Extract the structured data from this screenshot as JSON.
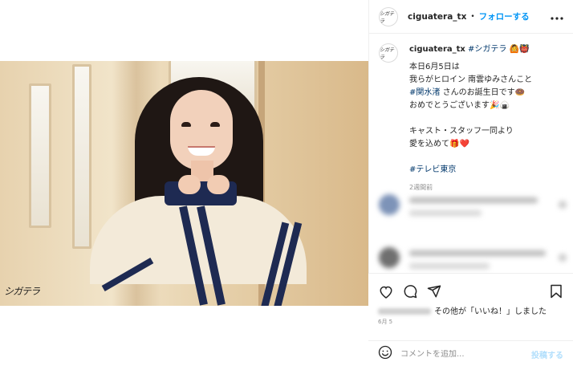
{
  "post": {
    "watermark": "シガテラ"
  },
  "header": {
    "avatar_text": "シガテラ",
    "username": "ciguatera_tx",
    "separator": "•",
    "follow_label": "フォローする",
    "more_icon": "more-horizontal-icon"
  },
  "caption": {
    "avatar_text": "シガテラ",
    "username": "ciguatera_tx",
    "hashtag_title": "#シガテラ",
    "title_emoji": "🙆👹",
    "lines": [
      "本日6月5日は",
      "我らがヒロイン 南雲ゆみさんこと",
      "さんのお誕生日です🍩",
      "おめでとうございます🎉🍙",
      "",
      "キャスト・スタッフ一同より",
      "愛を込めて🎁❤️",
      ""
    ],
    "actor_hashtag": "#関水渚",
    "footer_hashtag": "#テレビ東京",
    "time_ago": "2週間前"
  },
  "actions": {
    "icons": [
      "heart-icon",
      "comment-icon",
      "share-icon",
      "bookmark-icon"
    ],
    "likes_text": "その他が「いいね！」しました",
    "date": "6月 5"
  },
  "comment_box": {
    "emoji_icon": "smiley-icon",
    "placeholder": "コメントを追加...",
    "post_label": "投稿する"
  },
  "colors": {
    "link_blue": "#0095f6",
    "hashtag": "#00376b",
    "muted": "#8e8e8e",
    "navy_stripe": "#1e2a52"
  }
}
